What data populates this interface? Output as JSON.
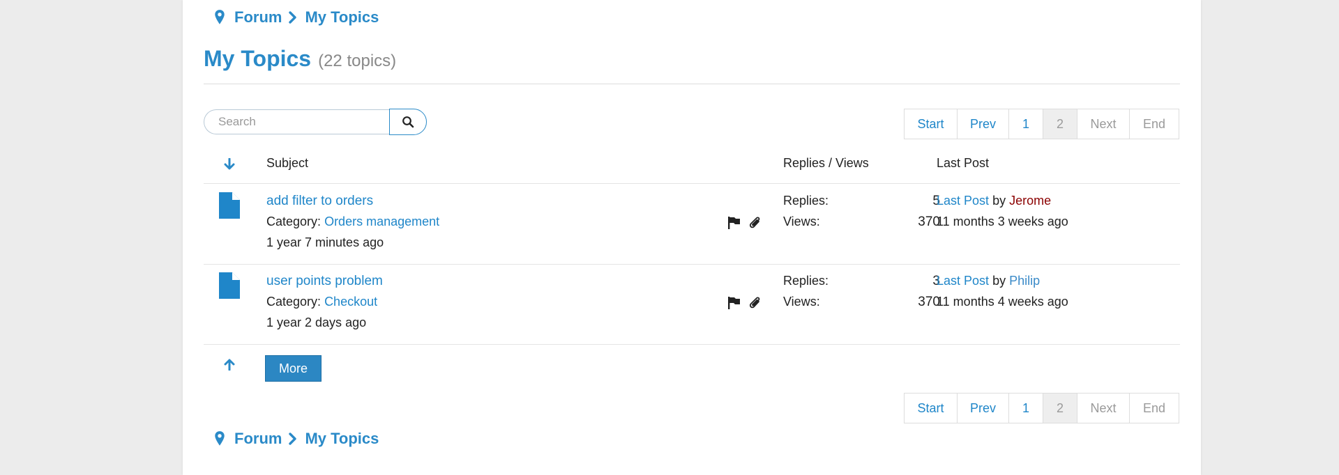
{
  "breadcrumb": {
    "forum": "Forum",
    "current": "My Topics"
  },
  "header": {
    "title": "My Topics",
    "count": "(22 topics)"
  },
  "search": {
    "placeholder": "Search"
  },
  "pagination": {
    "start": "Start",
    "prev": "Prev",
    "page1": "1",
    "page2": "2",
    "next": "Next",
    "end": "End"
  },
  "table": {
    "headers": {
      "subject": "Subject",
      "replies_views": "Replies / Views",
      "last_post": "Last Post"
    },
    "rows": [
      {
        "subject": "add filter to orders",
        "category_label": "Category:",
        "category": "Orders management",
        "age": "1 year 7 minutes ago",
        "replies_label": "Replies:",
        "replies": "5",
        "views_label": "Views:",
        "views": "370",
        "last_post_link": "Last Post",
        "by": "by",
        "author": "Jerome",
        "author_color": "#8b0000",
        "last_post_time": "11 months 3 weeks ago"
      },
      {
        "subject": "user points problem",
        "category_label": "Category:",
        "category": "Checkout",
        "age": "1 year 2 days ago",
        "replies_label": "Replies:",
        "replies": "3",
        "views_label": "Views:",
        "views": "370",
        "last_post_link": "Last Post",
        "by": "by",
        "author": "Philip",
        "author_color": "#3a8ac8",
        "last_post_time": "11 months 4 weeks ago"
      }
    ]
  },
  "more_button": "More",
  "colors": {
    "accent": "#2a8ac8",
    "link": "#1f86c9",
    "button": "#2c87c3"
  },
  "icons": [
    "map-pin-icon",
    "chevron-right-icon",
    "search-icon",
    "sort-down-arrow-icon",
    "document-icon",
    "flag-icon",
    "paperclip-icon",
    "sort-up-arrow-icon"
  ]
}
